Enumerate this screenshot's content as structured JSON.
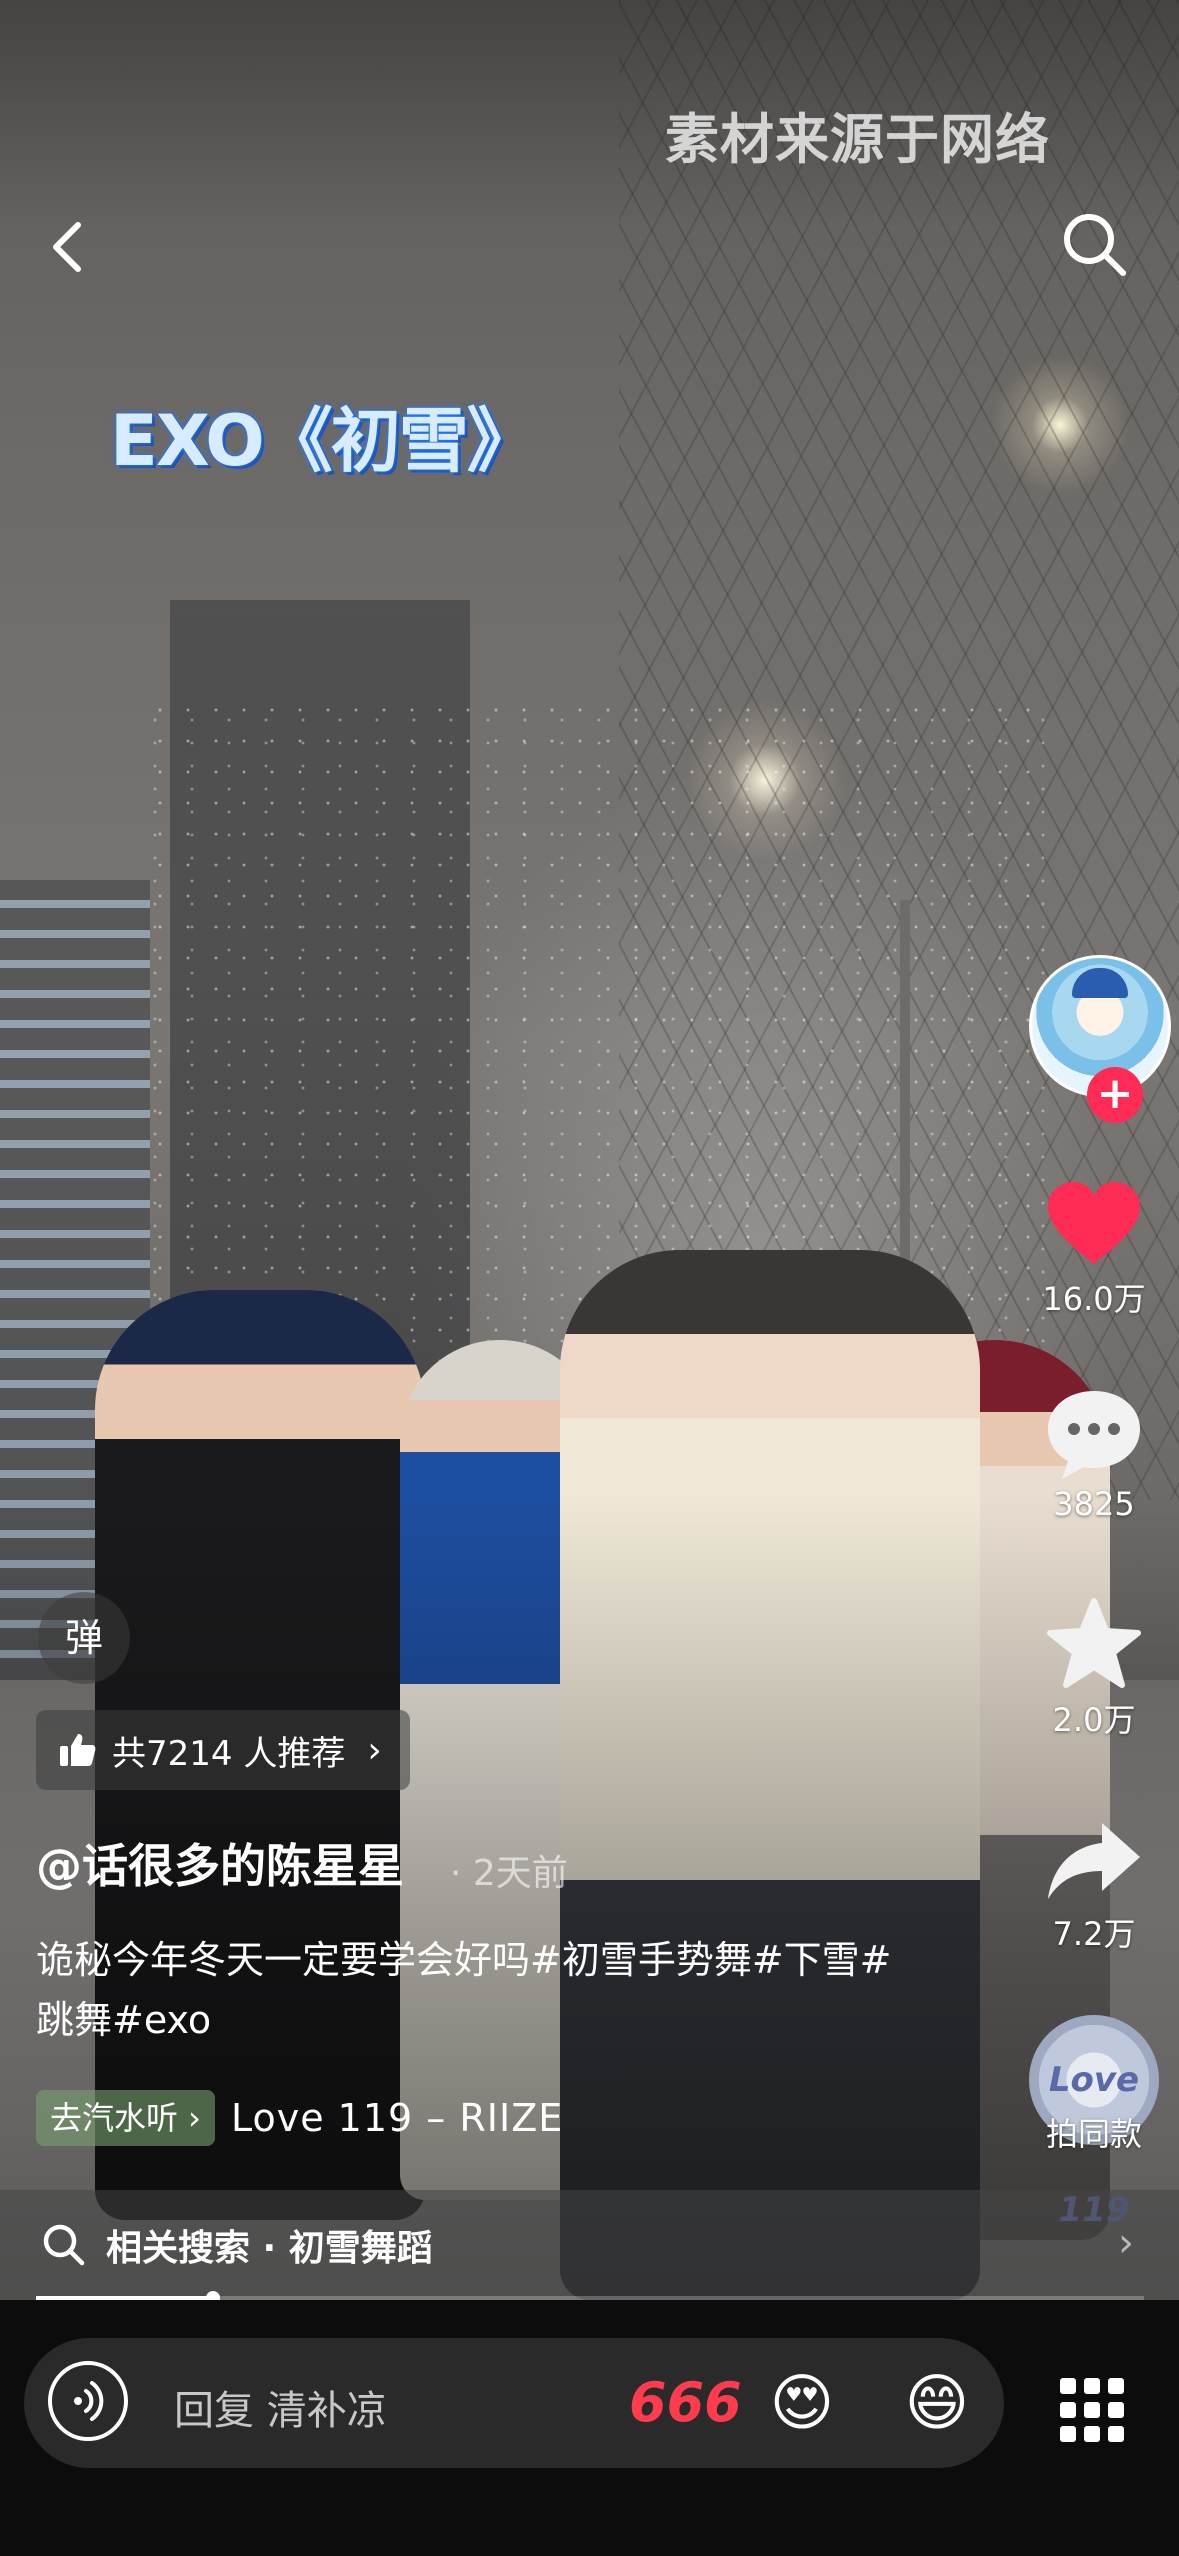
{
  "header": {
    "watermark": "素材来源于网络",
    "video_title_overlay": "EXO《初雪》"
  },
  "rail": {
    "like_count": "16.0万",
    "comment_count": "3825",
    "favorite_count": "2.0万",
    "share_count": "7.2万",
    "remix_label": "拍同款",
    "remix_disc_text": "Love 119"
  },
  "danmu_label": "弹",
  "recommend": {
    "label": "共7214 人推荐"
  },
  "post": {
    "author": "@话很多的陈星星",
    "time": "· 2天前",
    "description": "诡秘今年冬天一定要学会好吗#初雪手势舞#下雪#跳舞#exo"
  },
  "music": {
    "chip_label": "去汽水听 ›",
    "song": "Love 119 – RIIZE"
  },
  "related_search": {
    "label": "相关搜索 · 初雪舞蹈"
  },
  "progress": {
    "fraction": 0.16
  },
  "comment_bar": {
    "placeholder": "回复 清补凉",
    "emoji_666": "666",
    "emoji_love": "😍",
    "emoji_grin": "😄"
  },
  "colors": {
    "accent_red": "#fe2c55",
    "like_red": "#fe2c55"
  }
}
